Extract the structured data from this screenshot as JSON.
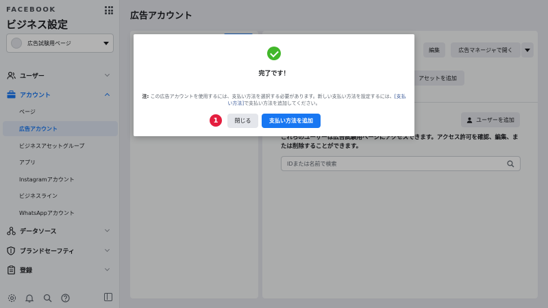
{
  "sidebar": {
    "brand": "FACEBOOK",
    "heading": "ビジネス設定",
    "account_select": "広告試験用ページ",
    "sections": [
      {
        "label": "ユーザー",
        "icon": "users-icon"
      },
      {
        "label": "アカウント",
        "icon": "briefcase-icon"
      },
      {
        "label": "データソース",
        "icon": "data-sources-icon"
      },
      {
        "label": "ブランドセーフティ",
        "icon": "shield-icon"
      },
      {
        "label": "登録",
        "icon": "clipboard-icon"
      }
    ],
    "account_items": [
      "ページ",
      "広告アカウント",
      "ビジネスアセットグループ",
      "アプリ",
      "Instagramアカウント",
      "ビジネスライン",
      "WhatsAppアカウント"
    ],
    "bottom_icons": [
      "gear-icon",
      "bell-icon",
      "search-icon",
      "help-icon"
    ]
  },
  "main": {
    "title": "広告アカウント",
    "edit_button": "編集",
    "ads_manager_button": "広告マネージャで開く",
    "add_asset_button": "アセットを追加",
    "add_user_button": "ユーザーを追加",
    "description": "これらのユーザーは広告試験用ページにアクセスできます。アクセス許可を確認、編集、または削除することができます。",
    "search_placeholder": "IDまたは名前で検索"
  },
  "modal": {
    "title": "完了です！",
    "note_prefix": "注:",
    "note_text": " この広告アカウントを使用するには、支払い方法を選択する必要があります。新しい支払い方法を設定するには、",
    "note_link": "[支払い方法]",
    "note_suffix": "で支払い方法を追加してください。",
    "step_number": "1",
    "close_button": "閉じる",
    "add_payment_button": "支払い方法を追加"
  },
  "colors": {
    "accent": "#1877f2",
    "success": "#42b72a",
    "step_badge": "#e41e3f"
  }
}
